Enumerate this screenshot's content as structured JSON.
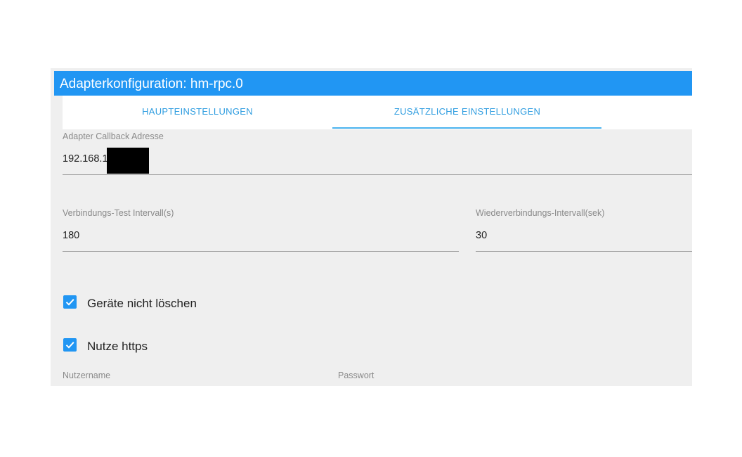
{
  "dialog": {
    "title": "Adapterkonfiguration: hm-rpc.0"
  },
  "tabs": [
    {
      "label": "HAUPTEINSTELLUNGEN",
      "active": false
    },
    {
      "label": "ZUSÄTZLICHE EINSTELLUNGEN",
      "active": true
    }
  ],
  "fields": {
    "callback_address": {
      "label": "Adapter Callback Adresse",
      "value": "192.168.1"
    },
    "connection_test_interval": {
      "label": "Verbindungs-Test Intervall(s)",
      "value": "180"
    },
    "reconnect_interval": {
      "label": "Wiederverbindungs-Intervall(sek)",
      "value": "30"
    },
    "username": {
      "label": "Nutzername"
    },
    "password": {
      "label": "Passwort"
    }
  },
  "checkboxes": {
    "dont_delete_devices": {
      "label": "Geräte nicht löschen",
      "checked": true
    },
    "use_https": {
      "label": "Nutze https",
      "checked": true
    }
  },
  "colors": {
    "accent": "#2196f3",
    "tab_text": "#2f9de0",
    "panel_bg": "#efefef"
  }
}
